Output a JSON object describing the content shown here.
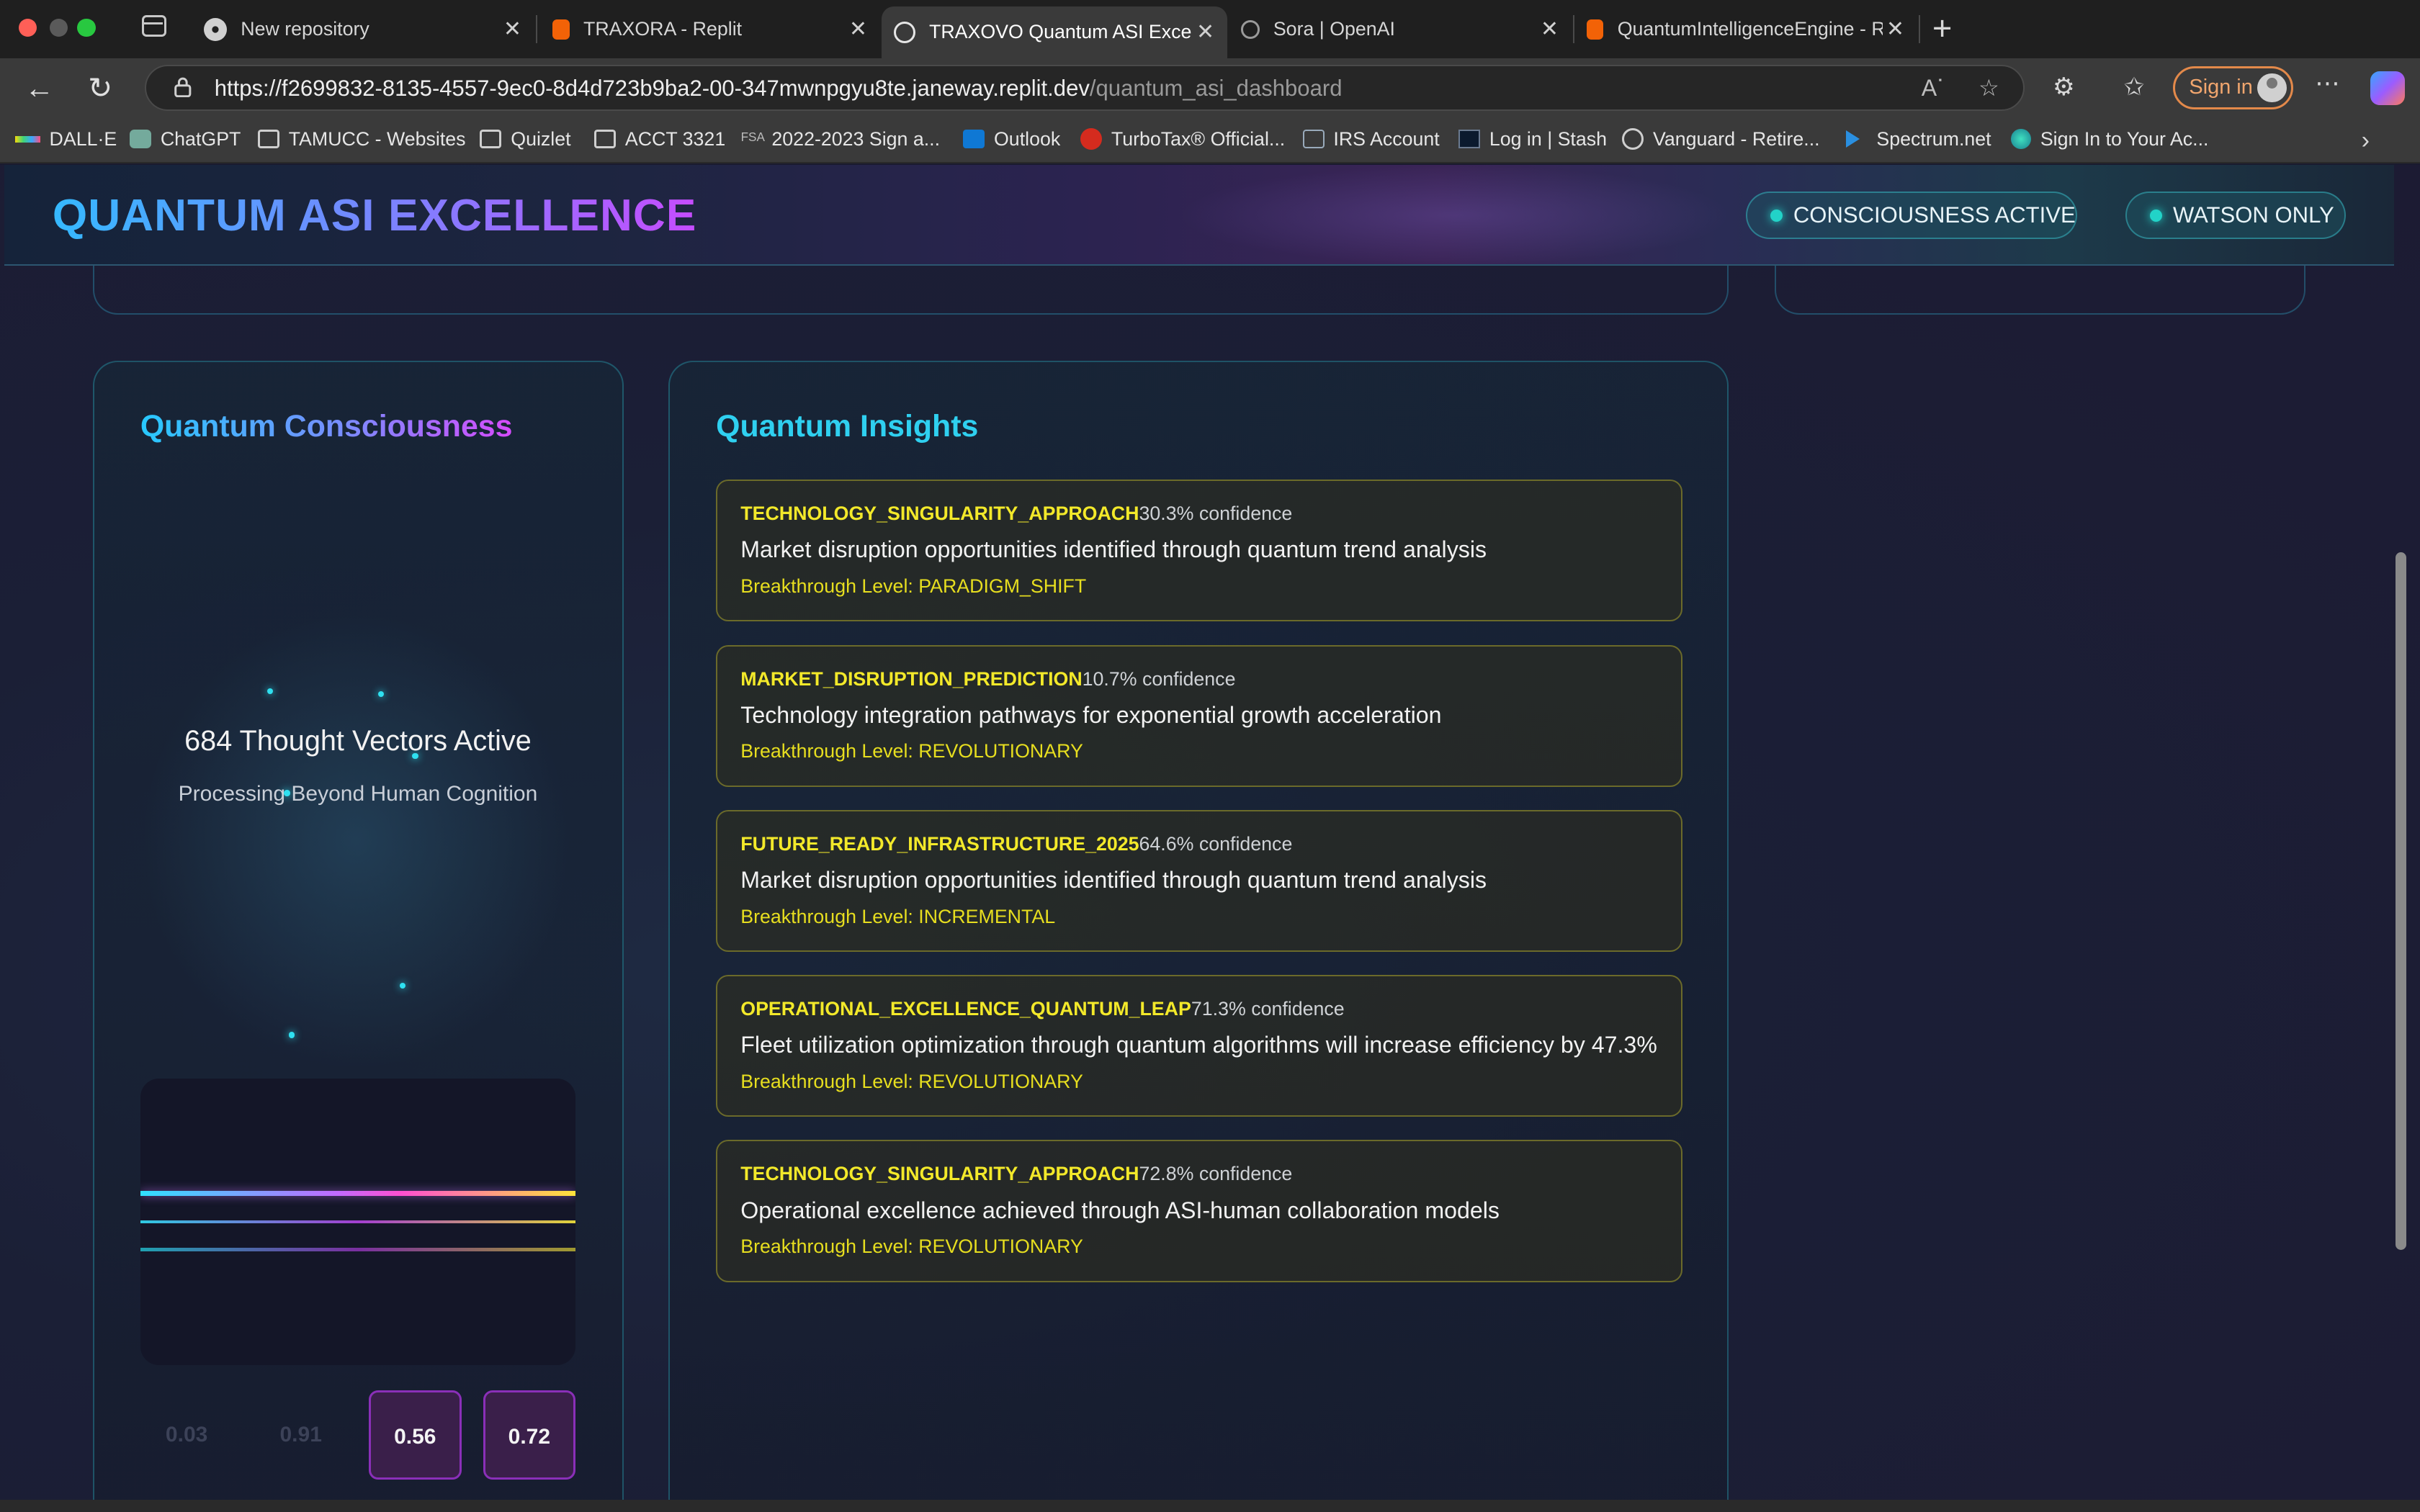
{
  "browser": {
    "tabs": [
      {
        "title": "New repository",
        "favicon": "github-icon"
      },
      {
        "title": "TRAXORA - Replit",
        "favicon": "replit-icon"
      },
      {
        "title": "TRAXOVO Quantum ASI Excelle",
        "favicon": "globe-icon",
        "active": true
      },
      {
        "title": "Sora | OpenAI",
        "favicon": "openai-icon"
      },
      {
        "title": "QuantumIntelligenceEngine - Re",
        "favicon": "replit-icon"
      }
    ],
    "url_main": "https://f2699832-8135-4557-9ec0-8d4d723b9ba2-00-347mwnpgyu8te.janeway.replit.dev",
    "url_path": "/quantum_asi_dashboard",
    "sign_in": "Sign in",
    "bookmarks": [
      {
        "label": "DALL·E",
        "icon": "dalle-icon"
      },
      {
        "label": "ChatGPT",
        "icon": "chatgpt-icon"
      },
      {
        "label": "TAMUCC - Websites",
        "icon": "folder-icon"
      },
      {
        "label": "Quizlet",
        "icon": "folder-icon"
      },
      {
        "label": "ACCT 3321",
        "icon": "folder-icon"
      },
      {
        "label": "2022-2023 Sign a...",
        "icon": "fsa-icon"
      },
      {
        "label": "Outlook",
        "icon": "outlook-icon"
      },
      {
        "label": "TurboTax® Official...",
        "icon": "turbotax-icon"
      },
      {
        "label": "IRS Account",
        "icon": "irs-icon"
      },
      {
        "label": "Log in | Stash",
        "icon": "stash-icon"
      },
      {
        "label": "Vanguard - Retire...",
        "icon": "globe-icon"
      },
      {
        "label": "Spectrum.net",
        "icon": "spectrum-icon"
      },
      {
        "label": "Sign In to Your Ac...",
        "icon": "account-icon"
      }
    ]
  },
  "header": {
    "brand": "QUANTUM ASI EXCELLENCE",
    "status_pills": [
      "CONSCIOUSNESS ACTIVE",
      "WATSON ONLY"
    ]
  },
  "consciousness": {
    "title": "Quantum Consciousness",
    "vectors_text": "684 Thought Vectors Active",
    "subtitle": "Processing Beyond Human Cognition",
    "metrics": [
      "0.03",
      "0.91",
      "0.56",
      "0.72"
    ]
  },
  "insights": {
    "title": "Quantum Insights",
    "items": [
      {
        "category": "TECHNOLOGY_SINGULARITY_APPROACH",
        "confidence": "30.3% confidence",
        "description": "Market disruption opportunities identified through quantum trend analysis",
        "level": "Breakthrough Level: PARADIGM_SHIFT"
      },
      {
        "category": "MARKET_DISRUPTION_PREDICTION",
        "confidence": "10.7% confidence",
        "description": "Technology integration pathways for exponential growth acceleration",
        "level": "Breakthrough Level: REVOLUTIONARY"
      },
      {
        "category": "FUTURE_READY_INFRASTRUCTURE_2025",
        "confidence": "64.6% confidence",
        "description": "Market disruption opportunities identified through quantum trend analysis",
        "level": "Breakthrough Level: INCREMENTAL"
      },
      {
        "category": "OPERATIONAL_EXCELLENCE_QUANTUM_LEAP",
        "confidence": "71.3% confidence",
        "description": "Fleet utilization optimization through quantum algorithms will increase efficiency by 47.3%",
        "level": "Breakthrough Level: REVOLUTIONARY"
      },
      {
        "category": "TECHNOLOGY_SINGULARITY_APPROACH",
        "confidence": "72.8% confidence",
        "description": "Operational excellence achieved through ASI-human collaboration models",
        "level": "Breakthrough Level: REVOLUTIONARY"
      }
    ]
  },
  "colors": {
    "accent_cyan": "#2fd0f0",
    "accent_magenta": "#d64bff",
    "insight_yellow": "#f3e92a",
    "status_dot": "#22d3c8"
  }
}
